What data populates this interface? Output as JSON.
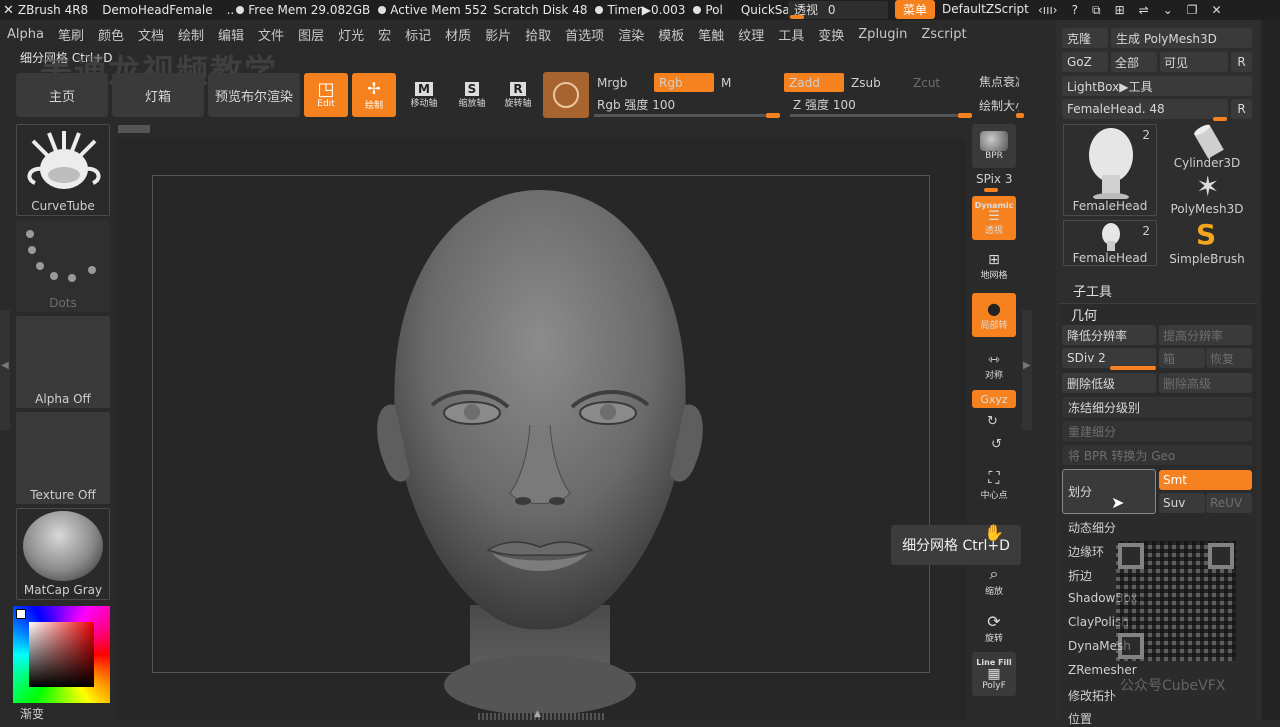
{
  "titlebar": {
    "app": "ZBrush 4R8",
    "doc": "DemoHeadFemale",
    "sep": "..",
    "free_mem": "Free Mem 29.082GB",
    "active_mem": "Active Mem 552",
    "scratch": "Scratch Disk 48",
    "timer": "Timer▶0.003",
    "pol": "Pol",
    "quicksave": "QuickSave",
    "opacity_label": "透视",
    "opacity_value": "0",
    "menu_button": "菜单",
    "script": "DefaultZScript"
  },
  "menubar": [
    "Alpha",
    "笔刷",
    "颜色",
    "文档",
    "绘制",
    "编辑",
    "文件",
    "图层",
    "灯光",
    "宏",
    "标记",
    "材质",
    "影片",
    "拾取",
    "首选项",
    "渲染",
    "模板",
    "笔触",
    "纹理",
    "工具",
    "变换",
    "Zplugin",
    "Zscript"
  ],
  "watermark_top": "美通龙视频教学",
  "tooltip_top": "细分网格 Ctrl+D",
  "toolbar": {
    "home": "主页",
    "lightbox": "灯箱",
    "bpr_preview": "预览布尔渲染",
    "edit": "Edit",
    "draw": "绘制",
    "move": "移动轴",
    "scale": "缩放轴",
    "rotate": "旋转轴",
    "mrgb": "Mrgb",
    "rgb": "Rgb",
    "m": "M",
    "rgb_intensity": "Rgb 强度 100",
    "zadd": "Zadd",
    "zsub": "Zsub",
    "zcut": "Zcut",
    "z_intensity": "Z 强度 100",
    "focal": "焦点衰减",
    "draw_size": "绘制大小"
  },
  "leftpanel": {
    "brush": "CurveTube",
    "stroke": "Dots",
    "alpha": "Alpha Off",
    "texture": "Texture Off",
    "material": "MatCap Gray",
    "gradient": "渐变"
  },
  "rightshelf": {
    "bpr": "BPR",
    "spix": "SPix 3",
    "dynamic": "Dynamic",
    "persp": "透视",
    "floor": "地网格",
    "local": "局部转",
    "sym": "对称",
    "xyz": "Gxyz",
    "center": "中心点",
    "scale": "缩放",
    "rotate": "旋转",
    "linefill": "Line Fill",
    "polyf": "PolyF"
  },
  "tooltip_canvas": "细分网格 Ctrl+D",
  "toolpanel": {
    "clone": "克隆",
    "make_polymesh": "生成 PolyMesh3D",
    "goz": "GoZ",
    "all": "全部",
    "visible": "可见",
    "r": "R",
    "lightbox_tool": "LightBox▶工具",
    "current_tool": "FemaleHead. 48",
    "tools": [
      {
        "name": "FemaleHead",
        "count": "2"
      },
      {
        "name": "Cylinder3D",
        "count": ""
      },
      {
        "name": "PolyMesh3D",
        "count": ""
      },
      {
        "name": "FemaleHead",
        "count": "2"
      },
      {
        "name": "SimpleBrush",
        "count": ""
      }
    ],
    "subtool": "子工具",
    "geometry": "几何",
    "lower_res": "降低分辨率",
    "higher_res": "提高分辨率",
    "sdiv": "SDiv 2",
    "cage": "箱",
    "reconstruct": "恢复",
    "del_lower": "删除低级",
    "del_higher": "删除高级",
    "freeze_sub": "冻结细分级别",
    "rebuild_sub": "重建细分",
    "bpr_to_geo": "将 BPR 转换为 Geo",
    "divide": "划分",
    "smt": "Smt",
    "suv": "Suv",
    "reuv": "ReUV",
    "dynamic_sub": "动态细分",
    "edge_loop": "边缘环",
    "crease": "折边",
    "shadowbox": "ShadowBox",
    "claypolish": "ClayPolish",
    "dynamesh": "DynaMesh",
    "zremesher": "ZRemesher",
    "modify_topo": "修改拓扑",
    "position": "位置"
  },
  "watermark_bottom": "公众号CubeVFX"
}
